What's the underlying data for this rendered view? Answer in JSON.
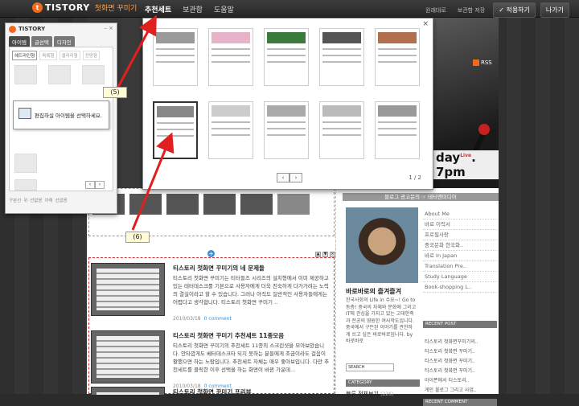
{
  "topbar": {
    "logo": "TISTORY",
    "logo_mark": "t",
    "subtitle": "첫화면 꾸미기",
    "nav": [
      "추천세트",
      "보관함",
      "도움말"
    ],
    "active_nav": 0,
    "links": [
      "원래대로",
      "보관함 저장"
    ],
    "apply_button": "✓ 적용하기",
    "exit_button": "나가기"
  },
  "panel": {
    "logo": "TISTORY",
    "controls": "– ×",
    "tabs": [
      "아이템",
      "글선택",
      "디자인"
    ],
    "subtabs": [
      "헤드라인형",
      "목록형",
      "갤러리형",
      "전망형"
    ],
    "hint": "편집하실 아이템을 선택하세요.",
    "prev": "‹",
    "next": "›",
    "footer": [
      "구분선",
      "위",
      "선없음",
      "아래",
      "선없음"
    ]
  },
  "popup": {
    "close": "×",
    "prev": "‹",
    "next": "›",
    "page_count": "1 / 2"
  },
  "annotations": {
    "label5": "(5)",
    "label6": "(6)"
  },
  "header": {
    "rss": "RSS",
    "date": "day",
    "date2": ". 7pm",
    "live": "Live"
  },
  "posts": [
    {
      "title": "티스토리 첫화면 꾸미기의 네 문제들",
      "body": "티스토리 첫화면 꾸미기는 티터들즈 시리즈의 설치형에서 이미 제공하고 있는 테터데스크를 기본으로 사용자에게 더욱 친숙하게 다가가려는 노력의 결실이라고 할 수 있습니다. 그러나 아직도 일반적인 사용자들에게는 어렵다고 생각합니다. 티스토리 첫화면 꾸미기 ..",
      "date": "2010/03/18",
      "comment": "0 comment"
    },
    {
      "title": "티스토리 첫화면 꾸미기 추천세트 11종모음",
      "body": "티스토리 첫화면 꾸미기의 추천세트 11종의 스크린샷을 모아보았습니다. 안타깝게도 베터데스크타 되지 못하는 분들에게 조금이라도 걸음이 활했으면 하는 노람입니다. 추천세트 자체는 매우 좋아보입니다. 다만 추천세트를 클릭한 이후 선택을 하는 화면이 바뀐 가운데...",
      "date": "2010/03/18",
      "comment": "0 comment"
    },
    {
      "title": "티스토리 첫화면 꾸미기 프리뷰",
      "body": "",
      "date": "",
      "comment": ""
    }
  ],
  "sidebar": {
    "banner": "블로그 광고문의 ☞ 테터앤미디어",
    "profile_name": "바로바로의 즐겨즐겨",
    "profile_text": "한국사회의 Life in 수요~! Go to 동층! 중국의 자체와 문화에 그리고 IT에 관심을 가지고 있는 고대한족과 전공의 영원한 여사학도입니다. 중국에서 구든된 이야기를 관찬하게 쓰고 싶은 바로바로입니다. by 바로바로",
    "search_placeholder": "SEARCH",
    "category_head": "CATEGORY",
    "category_item": "분류 전체보기",
    "category_count": "(226)",
    "links": [
      "About Me",
      "바로 이력서",
      "프로필사랑",
      "중국문화 한국화..",
      "바로 In Japan",
      "Translation Pre..",
      "Study Language",
      "Book-shopping L.."
    ],
    "recent_post_head": "RECENT POST",
    "recent_posts": [
      "티스토리 첫화면꾸미기의..",
      "티스토리 첫화면 꾸미기..",
      "티스토리 첫화면 꾸미기..",
      "티스토리 첫화면 꾸미기..",
      "아이폰에서 티스토리..",
      "게인 블로그 그리고 사업..",
      "협정도 하는 중국 BBS 게.."
    ],
    "recent_comment_head": "RECENT COMMENT"
  }
}
